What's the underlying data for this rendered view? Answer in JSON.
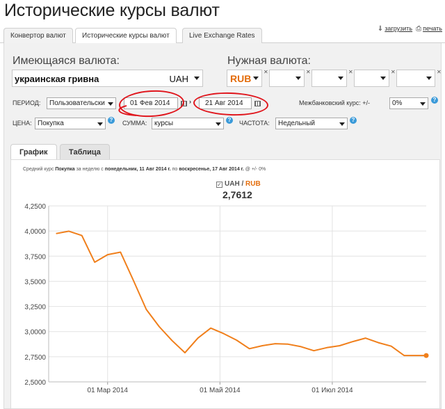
{
  "header": {
    "title": "Исторические курсы валют"
  },
  "tabs": [
    {
      "label": "Конвертор валют"
    },
    {
      "label": "Исторические курсы валют"
    },
    {
      "label": "Live Exchange Rates"
    }
  ],
  "toplinks": {
    "download": "загрузить",
    "print": "печать"
  },
  "form": {
    "have_label": "Имеющаяся валюта:",
    "need_label": "Нужная валюта:",
    "have_currency": {
      "name": "украинская гривна",
      "code": "UAH"
    },
    "need_currency": {
      "code": "RUB"
    },
    "period_label": "ПЕРИОД:",
    "period_value": "Пользовательски",
    "date_from": "01 Фев 2014",
    "date_to": "21 Авг 2014",
    "interbank_label": "Межбанковский курс: +/-",
    "interbank_value": "0%",
    "price_label": "ЦЕНА:",
    "price_value": "Покупка",
    "amount_label": "СУММА:",
    "amount_value": "курсы",
    "freq_label": "ЧАСТОТА:",
    "freq_value": "Недельный"
  },
  "chart_tabs": [
    {
      "label": "График"
    },
    {
      "label": "Таблица"
    }
  ],
  "caption": {
    "t1": "Средний курс",
    "t2": "Покупка",
    "t3": "за неделю с",
    "t4": "понедельник, 11 Авг 2014 г.",
    "t5": "по",
    "t6": "воскресенье, 17 Авг 2014 г.",
    "t7": "@ +/- 0%"
  },
  "legend": {
    "base": "UAH",
    "sep": "/",
    "quote": "RUB",
    "current_value": "2,7612"
  },
  "colors": {
    "line": "#f07f1b",
    "rub": "#e36c0a",
    "ring": "#e0151c",
    "help": "#3a9ad9"
  },
  "chart_data": {
    "type": "line",
    "series": [
      {
        "name": "UAH / RUB",
        "x": [
          "2014-02-01",
          "2014-02-08",
          "2014-02-15",
          "2014-02-22",
          "2014-03-01",
          "2014-03-08",
          "2014-03-15",
          "2014-03-22",
          "2014-03-29",
          "2014-04-05",
          "2014-04-12",
          "2014-04-19",
          "2014-04-26",
          "2014-05-03",
          "2014-05-10",
          "2014-05-17",
          "2014-05-24",
          "2014-05-31",
          "2014-06-07",
          "2014-06-14",
          "2014-06-21",
          "2014-06-28",
          "2014-07-05",
          "2014-07-12",
          "2014-07-19",
          "2014-07-26",
          "2014-08-02",
          "2014-08-09",
          "2014-08-16",
          "2014-08-21"
        ],
        "values": [
          3.975,
          3.998,
          3.955,
          3.69,
          3.765,
          3.79,
          3.51,
          3.22,
          3.05,
          2.91,
          2.79,
          2.935,
          3.035,
          2.98,
          2.915,
          2.83,
          2.86,
          2.88,
          2.875,
          2.85,
          2.81,
          2.84,
          2.86,
          2.9,
          2.935,
          2.89,
          2.855,
          2.762,
          2.762,
          2.762
        ]
      }
    ],
    "y_ticks": [
      "4,2500",
      "4,0000",
      "3,7500",
      "3,5000",
      "3,2500",
      "3,0000",
      "2,7500",
      "2,5000"
    ],
    "ylim": [
      2.5,
      4.25
    ],
    "x_ticks": [
      {
        "date": "2014-03-01",
        "label": "01 Мар 2014"
      },
      {
        "date": "2014-05-01",
        "label": "01 Май 2014"
      },
      {
        "date": "2014-07-01",
        "label": "01 Июл 2014"
      }
    ],
    "grid": true,
    "legend": "top"
  }
}
